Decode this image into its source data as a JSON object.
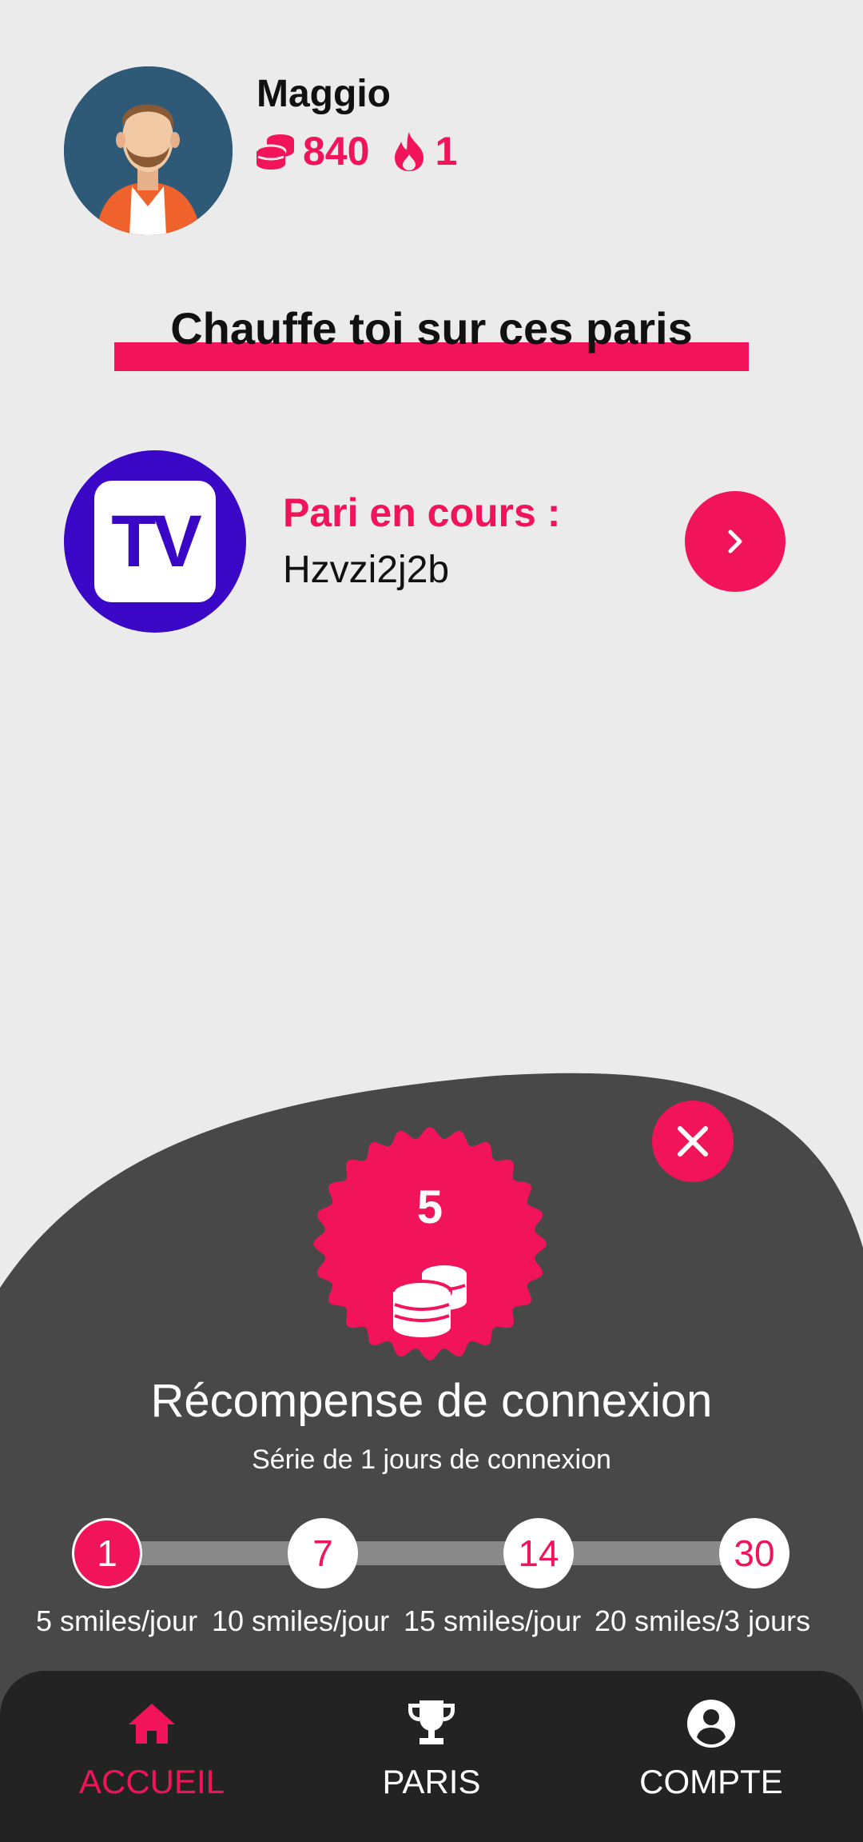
{
  "user": {
    "name": "Maggio",
    "coins": "840",
    "streak": "1",
    "coins_icon": "coins-icon",
    "streak_icon": "flame-icon"
  },
  "section": {
    "title": "Chauffe toi sur ces paris"
  },
  "current_bet": {
    "logo_text": "TV",
    "title": "Pari en cours :",
    "name": "Hzvzi2j2b"
  },
  "reward": {
    "amount": "5",
    "title": "Récompense de connexion",
    "streak_text": "Série de 1 jours de connexion",
    "milestones": [
      {
        "day": "1",
        "label": "5 smiles/jour",
        "active": true
      },
      {
        "day": "7",
        "label": "10 smiles/jour",
        "active": false
      },
      {
        "day": "14",
        "label": "15 smiles/jour",
        "active": false
      },
      {
        "day": "30",
        "label": "20 smiles/3 jours",
        "active": false
      }
    ]
  },
  "nav": {
    "items": [
      {
        "label": "ACCUEIL",
        "icon": "home-icon",
        "active": true
      },
      {
        "label": "PARIS",
        "icon": "trophy-icon",
        "active": false
      },
      {
        "label": "COMPTE",
        "icon": "account-icon",
        "active": false
      }
    ]
  },
  "colors": {
    "accent": "#f2145a",
    "background": "#ecebec",
    "sheet": "#484848",
    "nav": "#232323",
    "tv_brand": "#3a07c6"
  }
}
